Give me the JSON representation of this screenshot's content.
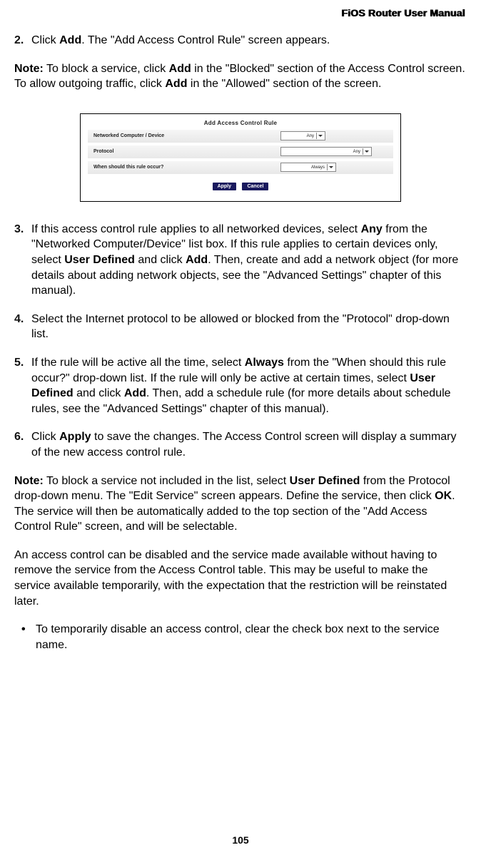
{
  "header": {
    "title": "FiOS Router User Manual"
  },
  "steps": {
    "s2": {
      "num": "2.",
      "pre": "Click ",
      "b1": "Add",
      "post": ". The \"Add Access Control Rule\" screen appears."
    },
    "s3": {
      "num": "3.",
      "pre": "If this access control rule applies to all networked devices, select ",
      "b1": "Any",
      "mid1": " from the \"Networked Computer/Device\" list box. If this rule applies to certain devices only, select ",
      "b2": "User Defined",
      "mid2": " and click ",
      "b3": "Add",
      "post": ". Then, create and add a network object (for more details about adding network objects, see the \"Advanced Settings\" chapter of this manual)."
    },
    "s4": {
      "num": "4.",
      "text": "Select the Internet protocol to be allowed or blocked from the \"Protocol\" drop-down list."
    },
    "s5": {
      "num": "5.",
      "pre": "If the rule will be active all the time, select ",
      "b1": "Always",
      "mid1": " from the \"When should this rule occur?\" drop-down list. If the rule will only be active at certain times, select ",
      "b2": "User Defined",
      "mid2": " and click ",
      "b3": "Add",
      "post": ". Then, add a schedule rule (for more details about schedule rules, see the \"Advanced Settings\" chapter of this manual)."
    },
    "s6": {
      "num": "6.",
      "pre": "Click ",
      "b1": "Apply",
      "post": " to save the changes. The Access Control screen will display a summary of the new access control rule."
    }
  },
  "note1": {
    "b1": "Note:",
    "pre": " To block a service, click ",
    "b2": "Add",
    "mid1": " in the \"Blocked\" section of the Access Control screen. To allow outgoing traffic, click ",
    "b3": "Add",
    "post": " in the \"Allowed\" section of the screen."
  },
  "note2": {
    "b1": "Note:",
    "pre": " To block a service not included in the list, select ",
    "b2": "User Defined",
    "mid1": " from the Protocol drop-down menu. The \"Edit Service\" screen appears. Define the service, then click ",
    "b3": "OK",
    "post": ". The service will then be automatically added to the top section of the \"Add Access Control Rule\" screen, and will be selectable."
  },
  "para1": "An access control can be disabled and the service made available without having to remove the service from the Access Control table. This may be useful to make the service available temporarily, with the expectation that the restriction will be reinstated later.",
  "bullet1": {
    "dot": "•",
    "text": "To temporarily disable an access control, clear the check box next to the service name."
  },
  "screenshot": {
    "title": "Add Access Control Rule",
    "row1": "Networked Computer / Device",
    "row2": "Protocol",
    "row3": "When should this rule occur?",
    "sel1": "Any",
    "sel2": "Any",
    "sel3": "Always",
    "btn1": "Apply",
    "btn2": "Cancel"
  },
  "page": "105"
}
